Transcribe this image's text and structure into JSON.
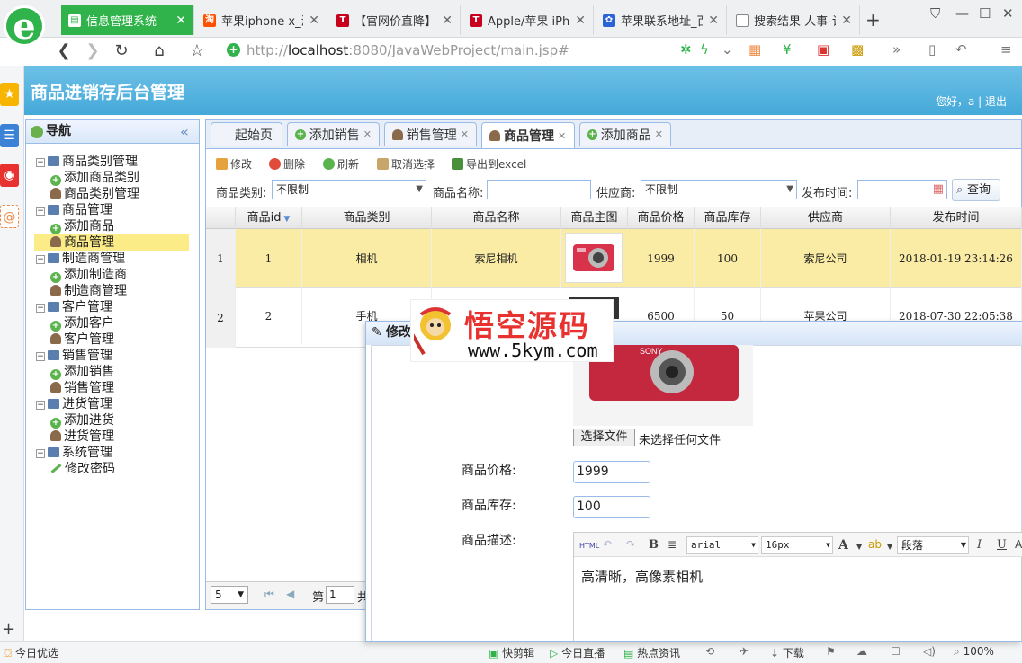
{
  "browser": {
    "tabs": [
      {
        "label": "信息管理系统",
        "active": true
      },
      {
        "label": "苹果iphone x_淘",
        "active": false
      },
      {
        "label": "【官网价直降】A",
        "active": false
      },
      {
        "label": "Apple/苹果 iPho",
        "active": false
      },
      {
        "label": "苹果联系地址_百",
        "active": false
      },
      {
        "label": "搜索结果 人事-记",
        "active": false
      }
    ],
    "url_prefix": "http://",
    "url_host": "localhost",
    "url_rest": ":8080/JavaWebProject/main.jsp#"
  },
  "app": {
    "title": "商品进销存后台管理",
    "greeting": "您好，a | 退出"
  },
  "nav": {
    "title": "导航",
    "tree": [
      {
        "label": "商品类别管理",
        "level": 0
      },
      {
        "label": "添加商品类别",
        "level": 1,
        "icon": "add"
      },
      {
        "label": "商品类别管理",
        "level": 1,
        "icon": "user"
      },
      {
        "label": "商品管理",
        "level": 0
      },
      {
        "label": "添加商品",
        "level": 1,
        "icon": "add"
      },
      {
        "label": "商品管理",
        "level": 1,
        "icon": "user",
        "selected": true
      },
      {
        "label": "制造商管理",
        "level": 0
      },
      {
        "label": "添加制造商",
        "level": 1,
        "icon": "add"
      },
      {
        "label": "制造商管理",
        "level": 1,
        "icon": "user"
      },
      {
        "label": "客户管理",
        "level": 0
      },
      {
        "label": "添加客户",
        "level": 1,
        "icon": "add"
      },
      {
        "label": "客户管理",
        "level": 1,
        "icon": "user"
      },
      {
        "label": "销售管理",
        "level": 0
      },
      {
        "label": "添加销售",
        "level": 1,
        "icon": "add"
      },
      {
        "label": "销售管理",
        "level": 1,
        "icon": "user"
      },
      {
        "label": "进货管理",
        "level": 0
      },
      {
        "label": "添加进货",
        "level": 1,
        "icon": "add"
      },
      {
        "label": "进货管理",
        "level": 1,
        "icon": "user"
      },
      {
        "label": "系统管理",
        "level": 0
      },
      {
        "label": "修改密码",
        "level": 1,
        "icon": "pencil"
      }
    ]
  },
  "main_tabs": [
    {
      "label": "起始页",
      "icon": "none"
    },
    {
      "label": "添加销售",
      "icon": "add",
      "closable": true
    },
    {
      "label": "销售管理",
      "icon": "user",
      "closable": true
    },
    {
      "label": "商品管理",
      "icon": "user",
      "closable": true,
      "active": true
    },
    {
      "label": "添加商品",
      "icon": "add",
      "closable": true
    }
  ],
  "toolbar": {
    "edit": "修改",
    "delete": "删除",
    "refresh": "刷新",
    "cancel_select": "取消选择",
    "export": "导出到excel"
  },
  "filters": {
    "category_label": "商品类别:",
    "category_value": "不限制",
    "name_label": "商品名称:",
    "name_value": "",
    "supplier_label": "供应商:",
    "supplier_value": "不限制",
    "date_label": "发布时间:",
    "date_value": "",
    "query_button": "查询"
  },
  "grid": {
    "columns": [
      "商品id",
      "商品类别",
      "商品名称",
      "商品主图",
      "商品价格",
      "商品库存",
      "供应商",
      "发布时间"
    ],
    "rows": [
      {
        "rownum": "1",
        "id": "1",
        "category": "相机",
        "name": "索尼相机",
        "price": "1999",
        "stock": "100",
        "supplier": "索尼公司",
        "date": "2018-01-19 23:14:26"
      },
      {
        "rownum": "2",
        "id": "2",
        "category": "手机",
        "name": "",
        "price": "6500",
        "stock": "50",
        "supplier": "苹果公司",
        "date": "2018-07-30 22:05:38"
      }
    ]
  },
  "pager": {
    "page_size": "5",
    "page_label": "第",
    "page_value": "1",
    "total_label": "共"
  },
  "watermark": {
    "title": "悟空源码",
    "url": "www.5kym.com"
  },
  "dialog": {
    "title": "修改",
    "choose_file": "选择文件",
    "no_file": "未选择任何文件",
    "price_label": "商品价格:",
    "price_value": "1999",
    "stock_label": "商品库存:",
    "stock_value": "100",
    "desc_label": "商品描述:",
    "editor": {
      "font": "arial",
      "size": "16px",
      "paragraph": "段落",
      "content": "高清晰，高像素相机"
    }
  },
  "statusbar": {
    "left": "今日优选",
    "items": [
      "快剪辑",
      "今日直播",
      "热点资讯",
      "下载"
    ],
    "zoom": "100%"
  }
}
